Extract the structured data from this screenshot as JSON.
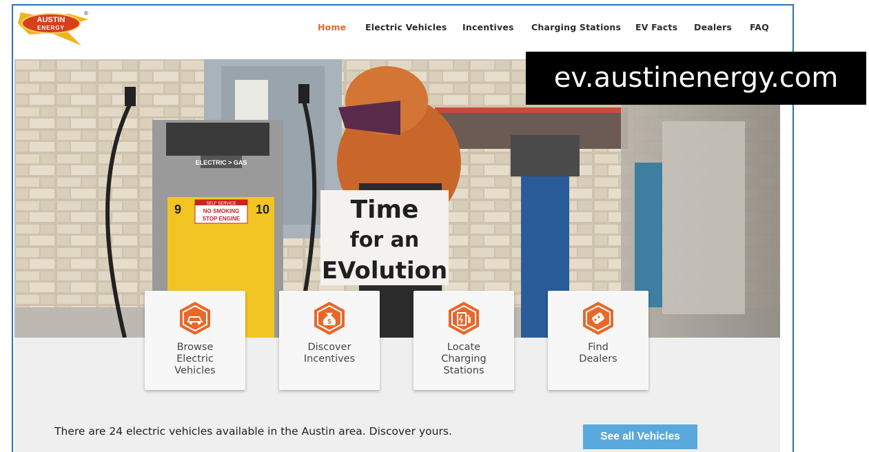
{
  "brand": {
    "logo_line1": "AUSTIN",
    "logo_line2": "ENERGY",
    "registered_mark": "®"
  },
  "nav": [
    {
      "label": "Home",
      "active": true
    },
    {
      "label": "Electric Vehicles",
      "active": false
    },
    {
      "label": "Incentives",
      "active": false
    },
    {
      "label": "Charging Stations",
      "active": false
    },
    {
      "label": "EV Facts",
      "active": false
    },
    {
      "label": "Dealers",
      "active": false
    },
    {
      "label": "FAQ",
      "active": false
    }
  ],
  "hero": {
    "sign_line1": "Time",
    "sign_line2": "for an",
    "sign_line3": "EVolution",
    "pump_label": "ELECTRIC > GAS",
    "pump_number_left": "9",
    "pump_number_right": "10",
    "pump_warning_line1": "SELF SERVICE",
    "pump_warning_line2": "NO SMOKING",
    "pump_warning_line3": "STOP ENGINE"
  },
  "cards": [
    {
      "label": "Browse\nElectric\nVehicles",
      "icon": "car-icon"
    },
    {
      "label": "Discover\nIncentives",
      "icon": "money-bag-icon"
    },
    {
      "label": "Locate\nCharging\nStations",
      "icon": "charging-station-icon"
    },
    {
      "label": "Find\nDealers",
      "icon": "car-key-icon"
    }
  ],
  "promo": {
    "text": "There are 24 electric vehicles available in the Austin area. Discover yours.",
    "button_label": "See all Vehicles"
  },
  "overlay": {
    "url": "ev.austinenergy.com"
  },
  "colors": {
    "accent_orange": "#e8682a",
    "button_blue": "#5aa9dc",
    "frame_blue": "#2f6fb5"
  }
}
